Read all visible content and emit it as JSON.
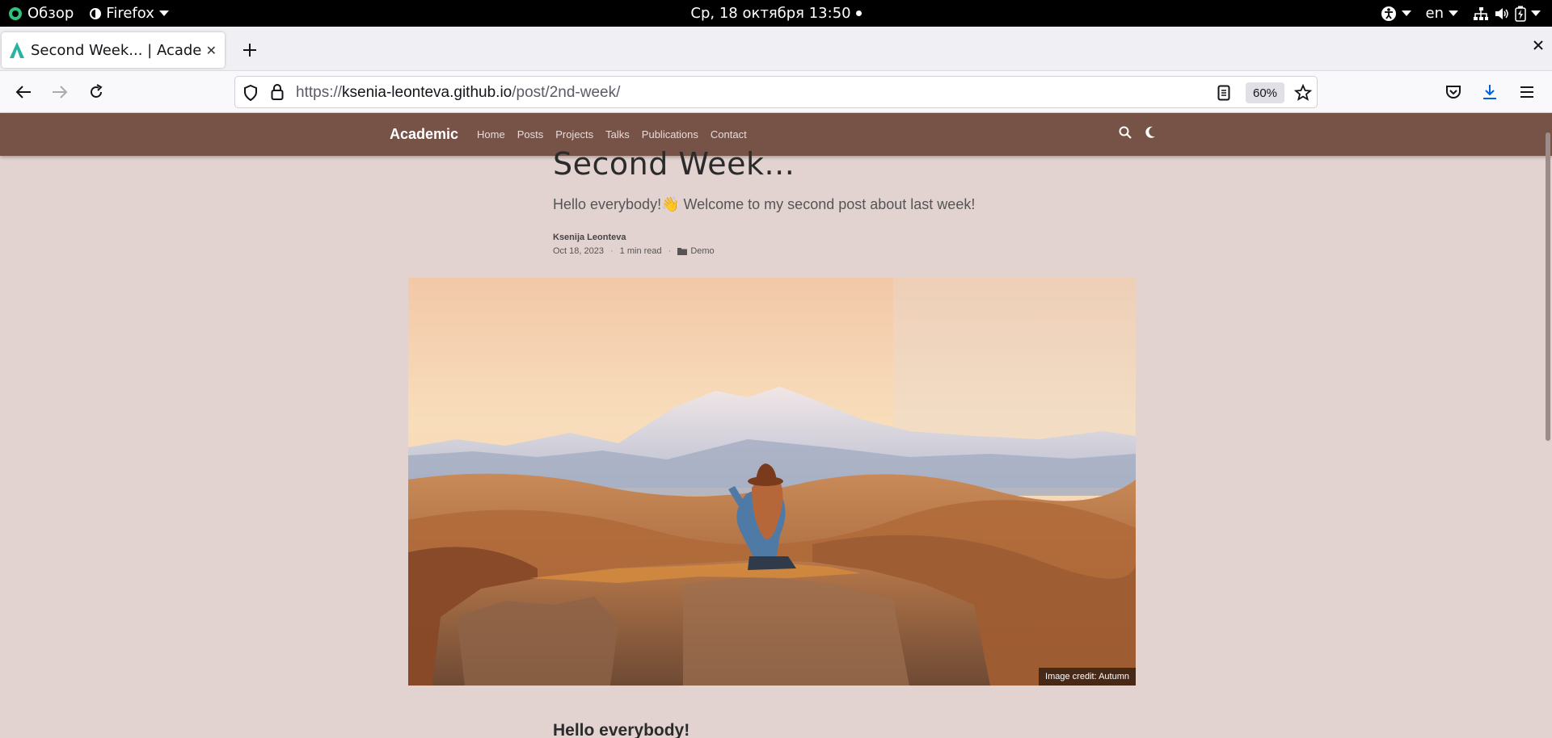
{
  "system_bar": {
    "activities": "Обзор",
    "app": "Firefox",
    "clock": "Ср, 18 октября  13:50",
    "language": "en"
  },
  "browser": {
    "tab_title": "Second Week... | Academic",
    "url_prefix": "https://",
    "url_host": "ksenia-leonteva.github.io",
    "url_path": "/post/2nd-week/",
    "zoom": "60%"
  },
  "site": {
    "brand": "Academic",
    "menu": [
      "Home",
      "Posts",
      "Projects",
      "Talks",
      "Publications",
      "Contact"
    ]
  },
  "article": {
    "title": "Second Week...",
    "summary": "Hello everybody!👋 Welcome to my second post about last week!",
    "author": "Ksenija Leonteva",
    "date": "Oct 18, 2023",
    "read_time": "1 min read",
    "category": "Demo",
    "image_credit": "Image credit: Autumn",
    "first_heading": "Hello everybody!"
  },
  "colors": {
    "site_header": "#765247",
    "page_background": "#e3d3d0"
  }
}
